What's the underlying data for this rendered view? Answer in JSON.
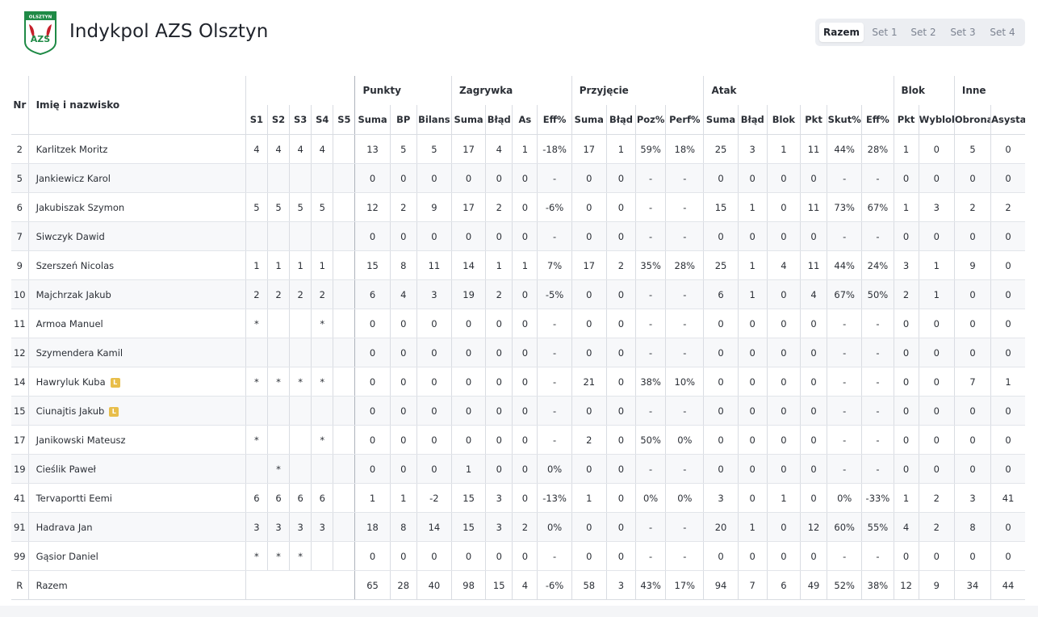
{
  "team": {
    "name": "Indykpol AZS Olsztyn",
    "logo_text": "OLSZTYN",
    "logo_letters": "AZS",
    "colors": {
      "logo_green": "#1f8a46",
      "logo_red": "#c6202b",
      "libero_badge": "#e8be4a"
    }
  },
  "set_tabs": [
    {
      "label": "Razem",
      "active": true
    },
    {
      "label": "Set 1",
      "active": false
    },
    {
      "label": "Set 2",
      "active": false
    },
    {
      "label": "Set 3",
      "active": false
    },
    {
      "label": "Set 4",
      "active": false
    }
  ],
  "table": {
    "fixed_headers": {
      "nr": "Nr",
      "name": "Imię i nazwisko"
    },
    "groups": [
      "Punkty",
      "Zagrywka",
      "Przyjęcie",
      "Atak",
      "Blok",
      "Inne"
    ],
    "columns": [
      "S1",
      "S2",
      "S3",
      "S4",
      "S5",
      "Suma",
      "BP",
      "Bilans",
      "Suma",
      "Błąd",
      "As",
      "Eff%",
      "Suma",
      "Błąd",
      "Poz%",
      "Perf%",
      "Suma",
      "Błąd",
      "Blok",
      "Pkt",
      "Skut%",
      "Eff%",
      "Pkt",
      "Wyblok",
      "Obrona",
      "Asysta"
    ],
    "rows": [
      {
        "nr": "2",
        "name": "Karlitzek Moritz",
        "libero": false,
        "cells": [
          "4",
          "4",
          "4",
          "4",
          "",
          "13",
          "5",
          "5",
          "17",
          "4",
          "1",
          "-18%",
          "17",
          "1",
          "59%",
          "18%",
          "25",
          "3",
          "1",
          "11",
          "44%",
          "28%",
          "1",
          "0",
          "5",
          "0"
        ]
      },
      {
        "nr": "5",
        "name": "Jankiewicz Karol",
        "libero": false,
        "cells": [
          "",
          "",
          "",
          "",
          "",
          "0",
          "0",
          "0",
          "0",
          "0",
          "0",
          "-",
          "0",
          "0",
          "-",
          "-",
          "0",
          "0",
          "0",
          "0",
          "-",
          "-",
          "0",
          "0",
          "0",
          "0"
        ]
      },
      {
        "nr": "6",
        "name": "Jakubiszak Szymon",
        "libero": false,
        "cells": [
          "5",
          "5",
          "5",
          "5",
          "",
          "12",
          "2",
          "9",
          "17",
          "2",
          "0",
          "-6%",
          "0",
          "0",
          "-",
          "-",
          "15",
          "1",
          "0",
          "11",
          "73%",
          "67%",
          "1",
          "3",
          "2",
          "2"
        ]
      },
      {
        "nr": "7",
        "name": "Siwczyk Dawid",
        "libero": false,
        "cells": [
          "",
          "",
          "",
          "",
          "",
          "0",
          "0",
          "0",
          "0",
          "0",
          "0",
          "-",
          "0",
          "0",
          "-",
          "-",
          "0",
          "0",
          "0",
          "0",
          "-",
          "-",
          "0",
          "0",
          "0",
          "0"
        ]
      },
      {
        "nr": "9",
        "name": "Szerszeń Nicolas",
        "libero": false,
        "cells": [
          "1",
          "1",
          "1",
          "1",
          "",
          "15",
          "8",
          "11",
          "14",
          "1",
          "1",
          "7%",
          "17",
          "2",
          "35%",
          "28%",
          "25",
          "1",
          "4",
          "11",
          "44%",
          "24%",
          "3",
          "1",
          "9",
          "0"
        ]
      },
      {
        "nr": "10",
        "name": "Majchrzak Jakub",
        "libero": false,
        "cells": [
          "2",
          "2",
          "2",
          "2",
          "",
          "6",
          "4",
          "3",
          "19",
          "2",
          "0",
          "-5%",
          "0",
          "0",
          "-",
          "-",
          "6",
          "1",
          "0",
          "4",
          "67%",
          "50%",
          "2",
          "1",
          "0",
          "0"
        ]
      },
      {
        "nr": "11",
        "name": "Armoa Manuel",
        "libero": false,
        "cells": [
          "*",
          "",
          "",
          "*",
          "",
          "0",
          "0",
          "0",
          "0",
          "0",
          "0",
          "-",
          "0",
          "0",
          "-",
          "-",
          "0",
          "0",
          "0",
          "0",
          "-",
          "-",
          "0",
          "0",
          "0",
          "0"
        ]
      },
      {
        "nr": "12",
        "name": "Szymendera Kamil",
        "libero": false,
        "cells": [
          "",
          "",
          "",
          "",
          "",
          "0",
          "0",
          "0",
          "0",
          "0",
          "0",
          "-",
          "0",
          "0",
          "-",
          "-",
          "0",
          "0",
          "0",
          "0",
          "-",
          "-",
          "0",
          "0",
          "0",
          "0"
        ]
      },
      {
        "nr": "14",
        "name": "Hawryluk Kuba",
        "libero": true,
        "cells": [
          "*",
          "*",
          "*",
          "*",
          "",
          "0",
          "0",
          "0",
          "0",
          "0",
          "0",
          "-",
          "21",
          "0",
          "38%",
          "10%",
          "0",
          "0",
          "0",
          "0",
          "-",
          "-",
          "0",
          "0",
          "7",
          "1"
        ]
      },
      {
        "nr": "15",
        "name": "Ciunajtis Jakub",
        "libero": true,
        "cells": [
          "",
          "",
          "",
          "",
          "",
          "0",
          "0",
          "0",
          "0",
          "0",
          "0",
          "-",
          "0",
          "0",
          "-",
          "-",
          "0",
          "0",
          "0",
          "0",
          "-",
          "-",
          "0",
          "0",
          "0",
          "0"
        ]
      },
      {
        "nr": "17",
        "name": "Janikowski Mateusz",
        "libero": false,
        "cells": [
          "*",
          "",
          "",
          "*",
          "",
          "0",
          "0",
          "0",
          "0",
          "0",
          "0",
          "-",
          "2",
          "0",
          "50%",
          "0%",
          "0",
          "0",
          "0",
          "0",
          "-",
          "-",
          "0",
          "0",
          "0",
          "0"
        ]
      },
      {
        "nr": "19",
        "name": "Cieślik Paweł",
        "libero": false,
        "cells": [
          "",
          "*",
          "",
          "",
          "",
          "0",
          "0",
          "0",
          "1",
          "0",
          "0",
          "0%",
          "0",
          "0",
          "-",
          "-",
          "0",
          "0",
          "0",
          "0",
          "-",
          "-",
          "0",
          "0",
          "0",
          "0"
        ]
      },
      {
        "nr": "41",
        "name": "Tervaportti Eemi",
        "libero": false,
        "cells": [
          "6",
          "6",
          "6",
          "6",
          "",
          "1",
          "1",
          "-2",
          "15",
          "3",
          "0",
          "-13%",
          "1",
          "0",
          "0%",
          "0%",
          "3",
          "0",
          "1",
          "0",
          "0%",
          "-33%",
          "1",
          "2",
          "3",
          "41"
        ]
      },
      {
        "nr": "91",
        "name": "Hadrava Jan",
        "libero": false,
        "cells": [
          "3",
          "3",
          "3",
          "3",
          "",
          "18",
          "8",
          "14",
          "15",
          "3",
          "2",
          "0%",
          "0",
          "0",
          "-",
          "-",
          "20",
          "1",
          "0",
          "12",
          "60%",
          "55%",
          "4",
          "2",
          "8",
          "0"
        ]
      },
      {
        "nr": "99",
        "name": "Gąsior Daniel",
        "libero": false,
        "cells": [
          "*",
          "*",
          "*",
          "",
          "",
          "0",
          "0",
          "0",
          "0",
          "0",
          "0",
          "-",
          "0",
          "0",
          "-",
          "-",
          "0",
          "0",
          "0",
          "0",
          "-",
          "-",
          "0",
          "0",
          "0",
          "0"
        ]
      }
    ],
    "libero_badge": "L",
    "total": {
      "nr": "R",
      "name": "Razem",
      "cells": [
        "65",
        "28",
        "40",
        "98",
        "15",
        "4",
        "-6%",
        "58",
        "3",
        "43%",
        "17%",
        "94",
        "7",
        "6",
        "49",
        "52%",
        "38%",
        "12",
        "9",
        "34",
        "44"
      ]
    }
  }
}
